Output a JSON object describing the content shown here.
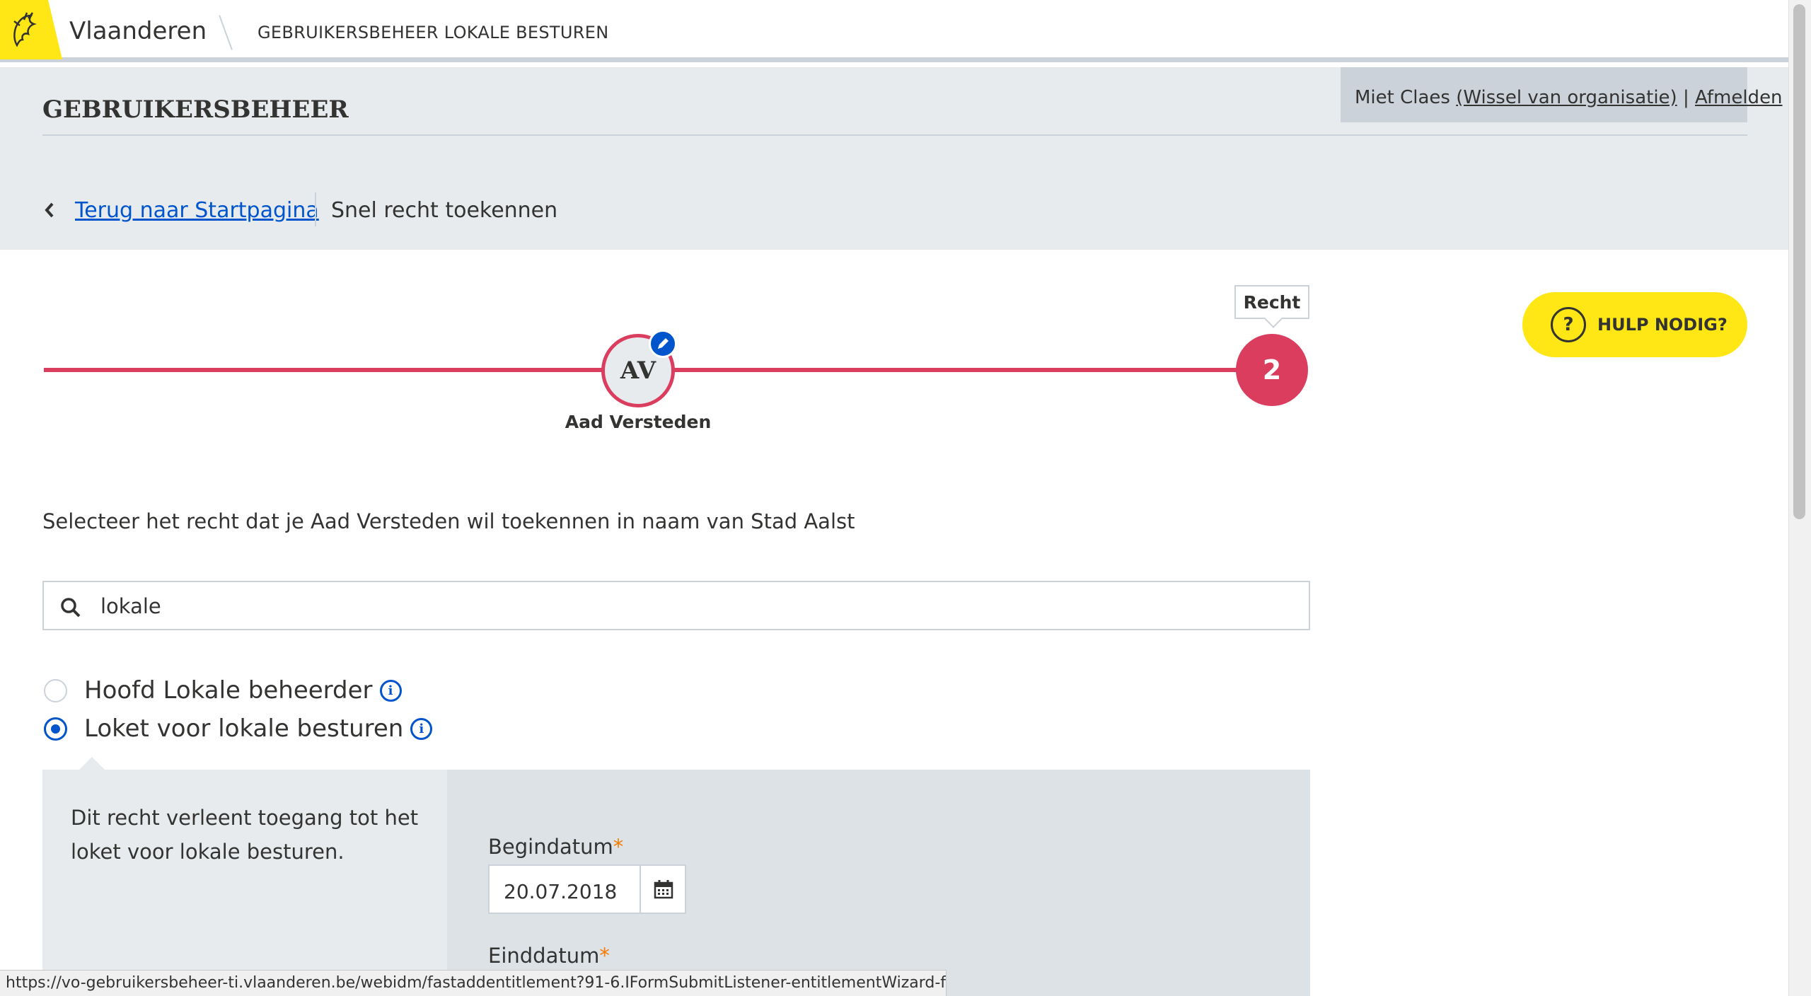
{
  "global_header": {
    "brand": "Vlaanderen",
    "app_title": "GEBRUIKERSBEHEER LOKALE BESTUREN"
  },
  "functional_header": {
    "title": "GEBRUIKERSBEHEER",
    "user_name": "Miet Claes",
    "switch_org_label": "(Wissel van organisatie)",
    "separator": "|",
    "logout_label": "Afmelden",
    "back_label": "Terug naar Startpagina",
    "current_page": "Snel recht toekennen"
  },
  "progress": {
    "step1_initials": "AV",
    "step1_name": "Aad Versteden",
    "step2_number": "2",
    "step2_tooltip": "Recht"
  },
  "help_button": {
    "icon_text": "?",
    "label": "HULP NODIG?"
  },
  "intro_text": "Selecteer het recht dat je Aad Versteden wil toekennen in naam van Stad Aalst",
  "search": {
    "value": "lokale",
    "placeholder": ""
  },
  "rights": [
    {
      "label": "Hoofd Lokale beheerder",
      "selected": false
    },
    {
      "label": "Loket voor lokale besturen",
      "selected": true
    }
  ],
  "info_icon_text": "i",
  "detail": {
    "description": "Dit recht verleent toegang tot het loket voor lokale besturen.",
    "begin_label": "Begindatum",
    "begin_value": "20.07.2018",
    "end_label": "Einddatum",
    "required_marker": "*"
  },
  "status_url": "https://vo-gebruikersbeheer-ti.vlaanderen.be/webidm/fastaddentitlement?91-6.IFormSubmitListener-entitlementWizard-form#",
  "colors": {
    "brand_yellow": "#ffe615",
    "progress_red": "#db3d5f",
    "link_blue": "#0055cc",
    "grey_bg": "#e8ebee",
    "required_orange": "#f37b00"
  }
}
